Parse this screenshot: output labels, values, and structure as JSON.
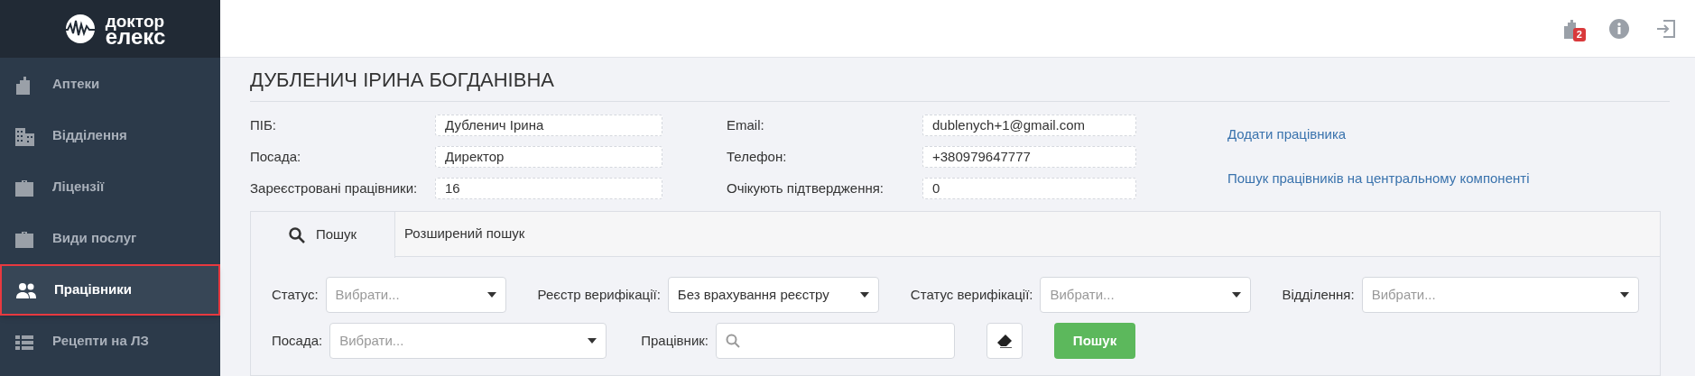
{
  "sidebar": {
    "logo": {
      "line_1": "доктор",
      "line_2": "елекс"
    },
    "items": [
      {
        "label": "Аптеки",
        "kind": "buildings",
        "selected": false
      },
      {
        "label": "Відділення",
        "kind": "office",
        "selected": false
      },
      {
        "label": "Ліцензії",
        "kind": "briefcase",
        "selected": false
      },
      {
        "label": "Види послуг",
        "kind": "briefcase",
        "selected": false
      },
      {
        "label": "Працівники",
        "kind": "users",
        "selected": true
      },
      {
        "label": "Рецепти на ЛЗ",
        "kind": "list",
        "selected": false
      }
    ]
  },
  "header": {
    "notification_badge": "2"
  },
  "title": "ДУБЛЕНИЧ ІРИНА БОГДАНІВНА",
  "details": [
    {
      "label": "ПІБ:",
      "value": "Дубленич Ірина"
    },
    {
      "label": "Посада:",
      "value": "Директор"
    },
    {
      "label": "Зареєстровані працівники:",
      "value": "16"
    },
    {
      "label": "Email:",
      "value": "dublenych+1@gmail.com"
    },
    {
      "label": "Телефон:",
      "value": "+380979647777"
    },
    {
      "label": "Очікують підтвердження:",
      "value": "0"
    }
  ],
  "links": [
    "Додати працівника",
    "Пошук працівників на центральному компоненті"
  ],
  "tabs": [
    {
      "label": "Пошук",
      "selected": true
    },
    {
      "label": "Розширений пошук",
      "selected": false
    }
  ],
  "filters": [
    [
      {
        "kind": "select",
        "label": "Статус:",
        "placeholder": "Вибрати..."
      },
      {
        "kind": "select",
        "label": "Реєстр верифікації:",
        "value": "Без врахування реєстру"
      },
      {
        "kind": "select",
        "label": "Статус верифікації:",
        "placeholder": "Вибрати..."
      },
      {
        "kind": "select",
        "label": "Відділення:",
        "placeholder": "Вибрати..."
      }
    ],
    [
      {
        "kind": "select",
        "label": "Посада:",
        "placeholder": "Вибрати..."
      },
      {
        "kind": "search",
        "label": "Працівник:"
      },
      {
        "kind": "clear"
      },
      {
        "kind": "submit",
        "label": "Пошук"
      }
    ]
  ]
}
